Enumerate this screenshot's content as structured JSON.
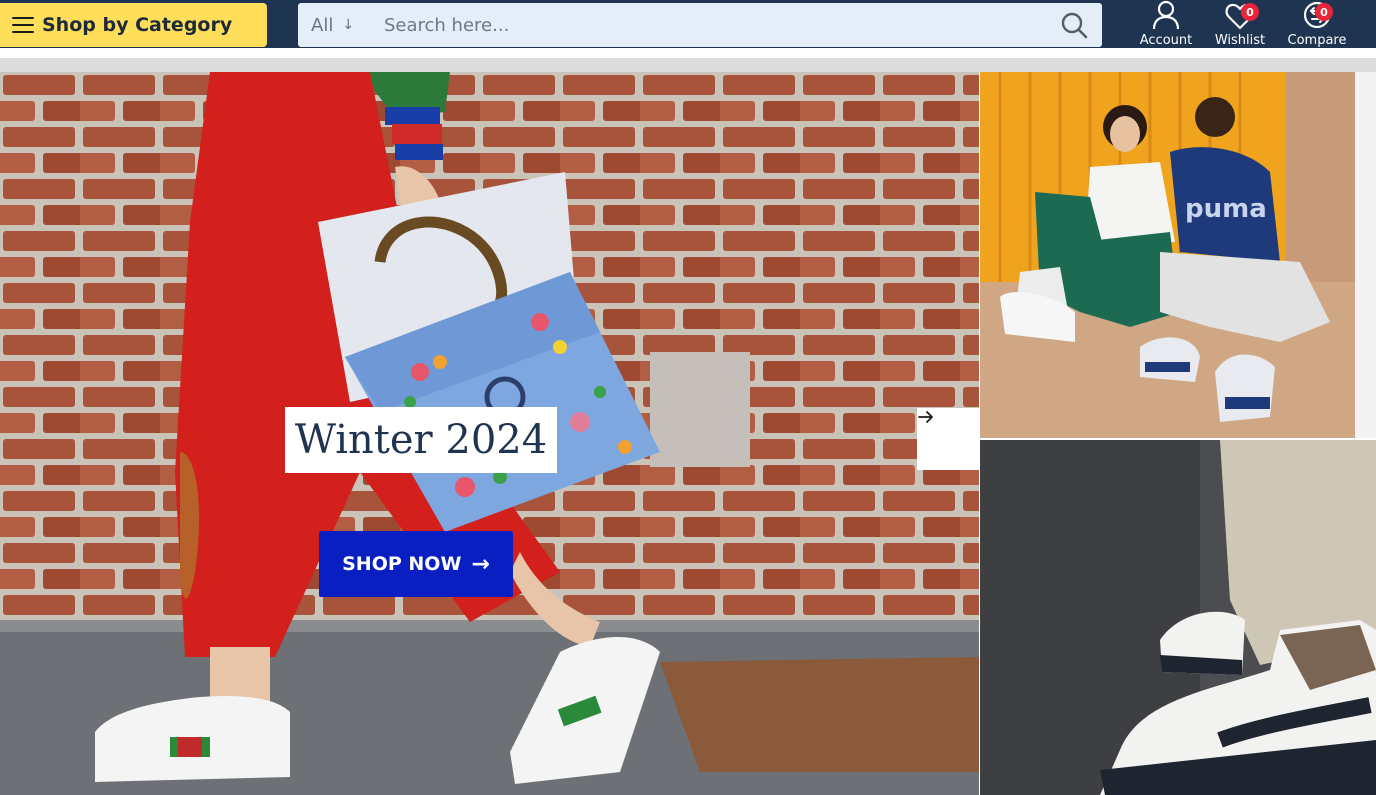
{
  "header": {
    "category_label": "Shop by Category",
    "search_scope": "All",
    "search_placeholder": "Search here...",
    "account_label": "Account",
    "wishlist_label": "Wishlist",
    "wishlist_count": "0",
    "compare_label": "Compare",
    "compare_count": "0"
  },
  "hero": {
    "title": "Winter 2024",
    "cta_label": "SHOP NOW",
    "next_icon": "arrow-right-icon"
  },
  "side_banners": {
    "top_logo_text": "puma"
  },
  "colors": {
    "header_bg": "#1e3450",
    "category_button": "#ffde59",
    "search_bg": "#e4eef9",
    "badge": "#e8243b",
    "cta_bg": "#0a1fc2",
    "title_text": "#1e3450"
  },
  "icons": {
    "menu": "hamburger-icon",
    "search": "search-icon",
    "account": "user-icon",
    "wishlist": "heart-icon",
    "compare": "compare-arrows-icon"
  }
}
